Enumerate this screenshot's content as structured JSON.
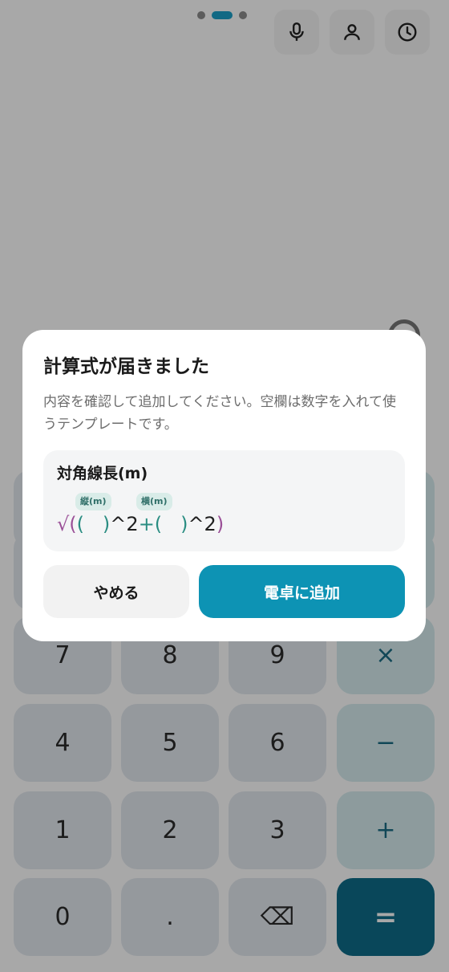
{
  "top": {
    "pages": 3,
    "active_page": 2,
    "icons": [
      "microphone-icon",
      "person-icon",
      "history-clock-icon"
    ]
  },
  "keypad": {
    "rows": [
      [
        {
          "label": "7",
          "type": "num"
        },
        {
          "label": "8",
          "type": "num"
        },
        {
          "label": "9",
          "type": "num"
        },
        {
          "label": "×",
          "type": "op"
        }
      ],
      [
        {
          "label": "4",
          "type": "num"
        },
        {
          "label": "5",
          "type": "num"
        },
        {
          "label": "6",
          "type": "num"
        },
        {
          "label": "−",
          "type": "op"
        }
      ],
      [
        {
          "label": "1",
          "type": "num"
        },
        {
          "label": "2",
          "type": "num"
        },
        {
          "label": "3",
          "type": "num"
        },
        {
          "label": "+",
          "type": "op"
        }
      ],
      [
        {
          "label": "0",
          "type": "num"
        },
        {
          "label": ".",
          "type": "num"
        },
        {
          "label": "⌫",
          "type": "num"
        },
        {
          "label": "=",
          "type": "eq"
        }
      ]
    ]
  },
  "dialog": {
    "title": "計算式が届きました",
    "description": "内容を確認して追加してください。空欄は数字を入れて使うテンプレートです。",
    "formula": {
      "name": "対角線長(m)",
      "chip_1": "縦(m)",
      "chip_2": "横(m)",
      "expr": {
        "p1": "√(",
        "p2": "(",
        "p3": "   ",
        "p4": ")",
        "p5": "^2",
        "p6": "+",
        "p7": "(",
        "p8": "   ",
        "p9": ")",
        "p10": "^2",
        "p11": ")"
      }
    },
    "cancel_label": "やめる",
    "add_label": "電卓に追加"
  },
  "colors": {
    "accent": "#0d93b4",
    "equals_key": "#0e6d89",
    "formula_purple": "#9a4f97",
    "formula_teal": "#2a8d82"
  }
}
